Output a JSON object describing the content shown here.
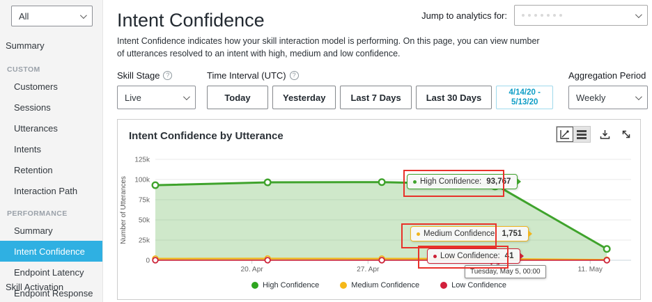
{
  "sidebar": {
    "skill_selector_value": "All",
    "summary_top": "Summary",
    "custom": {
      "title": "CUSTOM",
      "items": [
        "Customers",
        "Sessions",
        "Utterances",
        "Intents",
        "Retention",
        "Interaction Path"
      ]
    },
    "performance": {
      "title": "PERFORMANCE",
      "items": [
        "Summary",
        "Intent Confidence",
        "Endpoint Latency",
        "Endpoint Response"
      ]
    },
    "selected_item": "Intent Confidence",
    "selected_color": "#2fb0e2",
    "skill_activation": "Skill Activation"
  },
  "header": {
    "title": "Intent Confidence",
    "description": "Intent Confidence indicates how your skill interaction model is performing. On this page, you can view number of utterances resolved to an intent with high, medium and low confidence.",
    "jump_label": "Jump to analytics for:"
  },
  "filters": {
    "skill_stage_label": "Skill Stage",
    "skill_stage_value": "Live",
    "time_interval_label": "Time Interval (UTC)",
    "buttons": [
      "Today",
      "Yesterday",
      "Last 7 Days",
      "Last 30 Days"
    ],
    "date_range_line1": "4/14/20 -",
    "date_range_line2": "5/13/20",
    "aggregation_label": "Aggregation Period",
    "aggregation_value": "Weekly"
  },
  "panel": {
    "title": "Intent Confidence by Utterance"
  },
  "chart_data": {
    "type": "area",
    "title": "Intent Confidence by Utterance",
    "ylabel": "Number of Utterances",
    "ylim": [
      0,
      125000
    ],
    "yticks": [
      {
        "v": 0,
        "label": "0"
      },
      {
        "v": 25000,
        "label": "25k"
      },
      {
        "v": 50000,
        "label": "50k"
      },
      {
        "v": 75000,
        "label": "75k"
      },
      {
        "v": 100000,
        "label": "100k"
      },
      {
        "v": 125000,
        "label": "125k"
      }
    ],
    "xticks": [
      {
        "frac": 0.203,
        "label": "20. Apr"
      },
      {
        "frac": 0.447,
        "label": "27. Apr"
      },
      {
        "frac": 0.914,
        "label": "11. May"
      }
    ],
    "x_fracs": [
      0,
      0.236,
      0.476,
      0.714,
      0.949
    ],
    "series": [
      {
        "name": "High Confidence",
        "color": "#3fa32c",
        "fill": "rgba(63,163,44,0.25)",
        "values": [
          93000,
          96500,
          96800,
          93767,
          14000
        ]
      },
      {
        "name": "Medium Confidence",
        "color": "#f0b41e",
        "values": [
          2000,
          2100,
          2000,
          1751,
          600
        ]
      },
      {
        "name": "Low Confidence",
        "color": "#cc2136",
        "values": [
          60,
          55,
          50,
          41,
          25
        ]
      }
    ],
    "selected_index": 3,
    "crosshair_label": "Tuesday, May 5, 00:00",
    "tooltips": [
      {
        "label": "High Confidence:",
        "value": "93,767"
      },
      {
        "label": "Medium Confidence:",
        "value": "1,751"
      },
      {
        "label": "Low Confidence:",
        "value": "41"
      }
    ],
    "legend": [
      {
        "label": "High Confidence",
        "color": "#2ea51f"
      },
      {
        "label": "Medium Confidence",
        "color": "#f5b819"
      },
      {
        "label": "Low Confidence",
        "color": "#d21f3c"
      }
    ],
    "legend_position": "bottom-center",
    "grid": true
  }
}
